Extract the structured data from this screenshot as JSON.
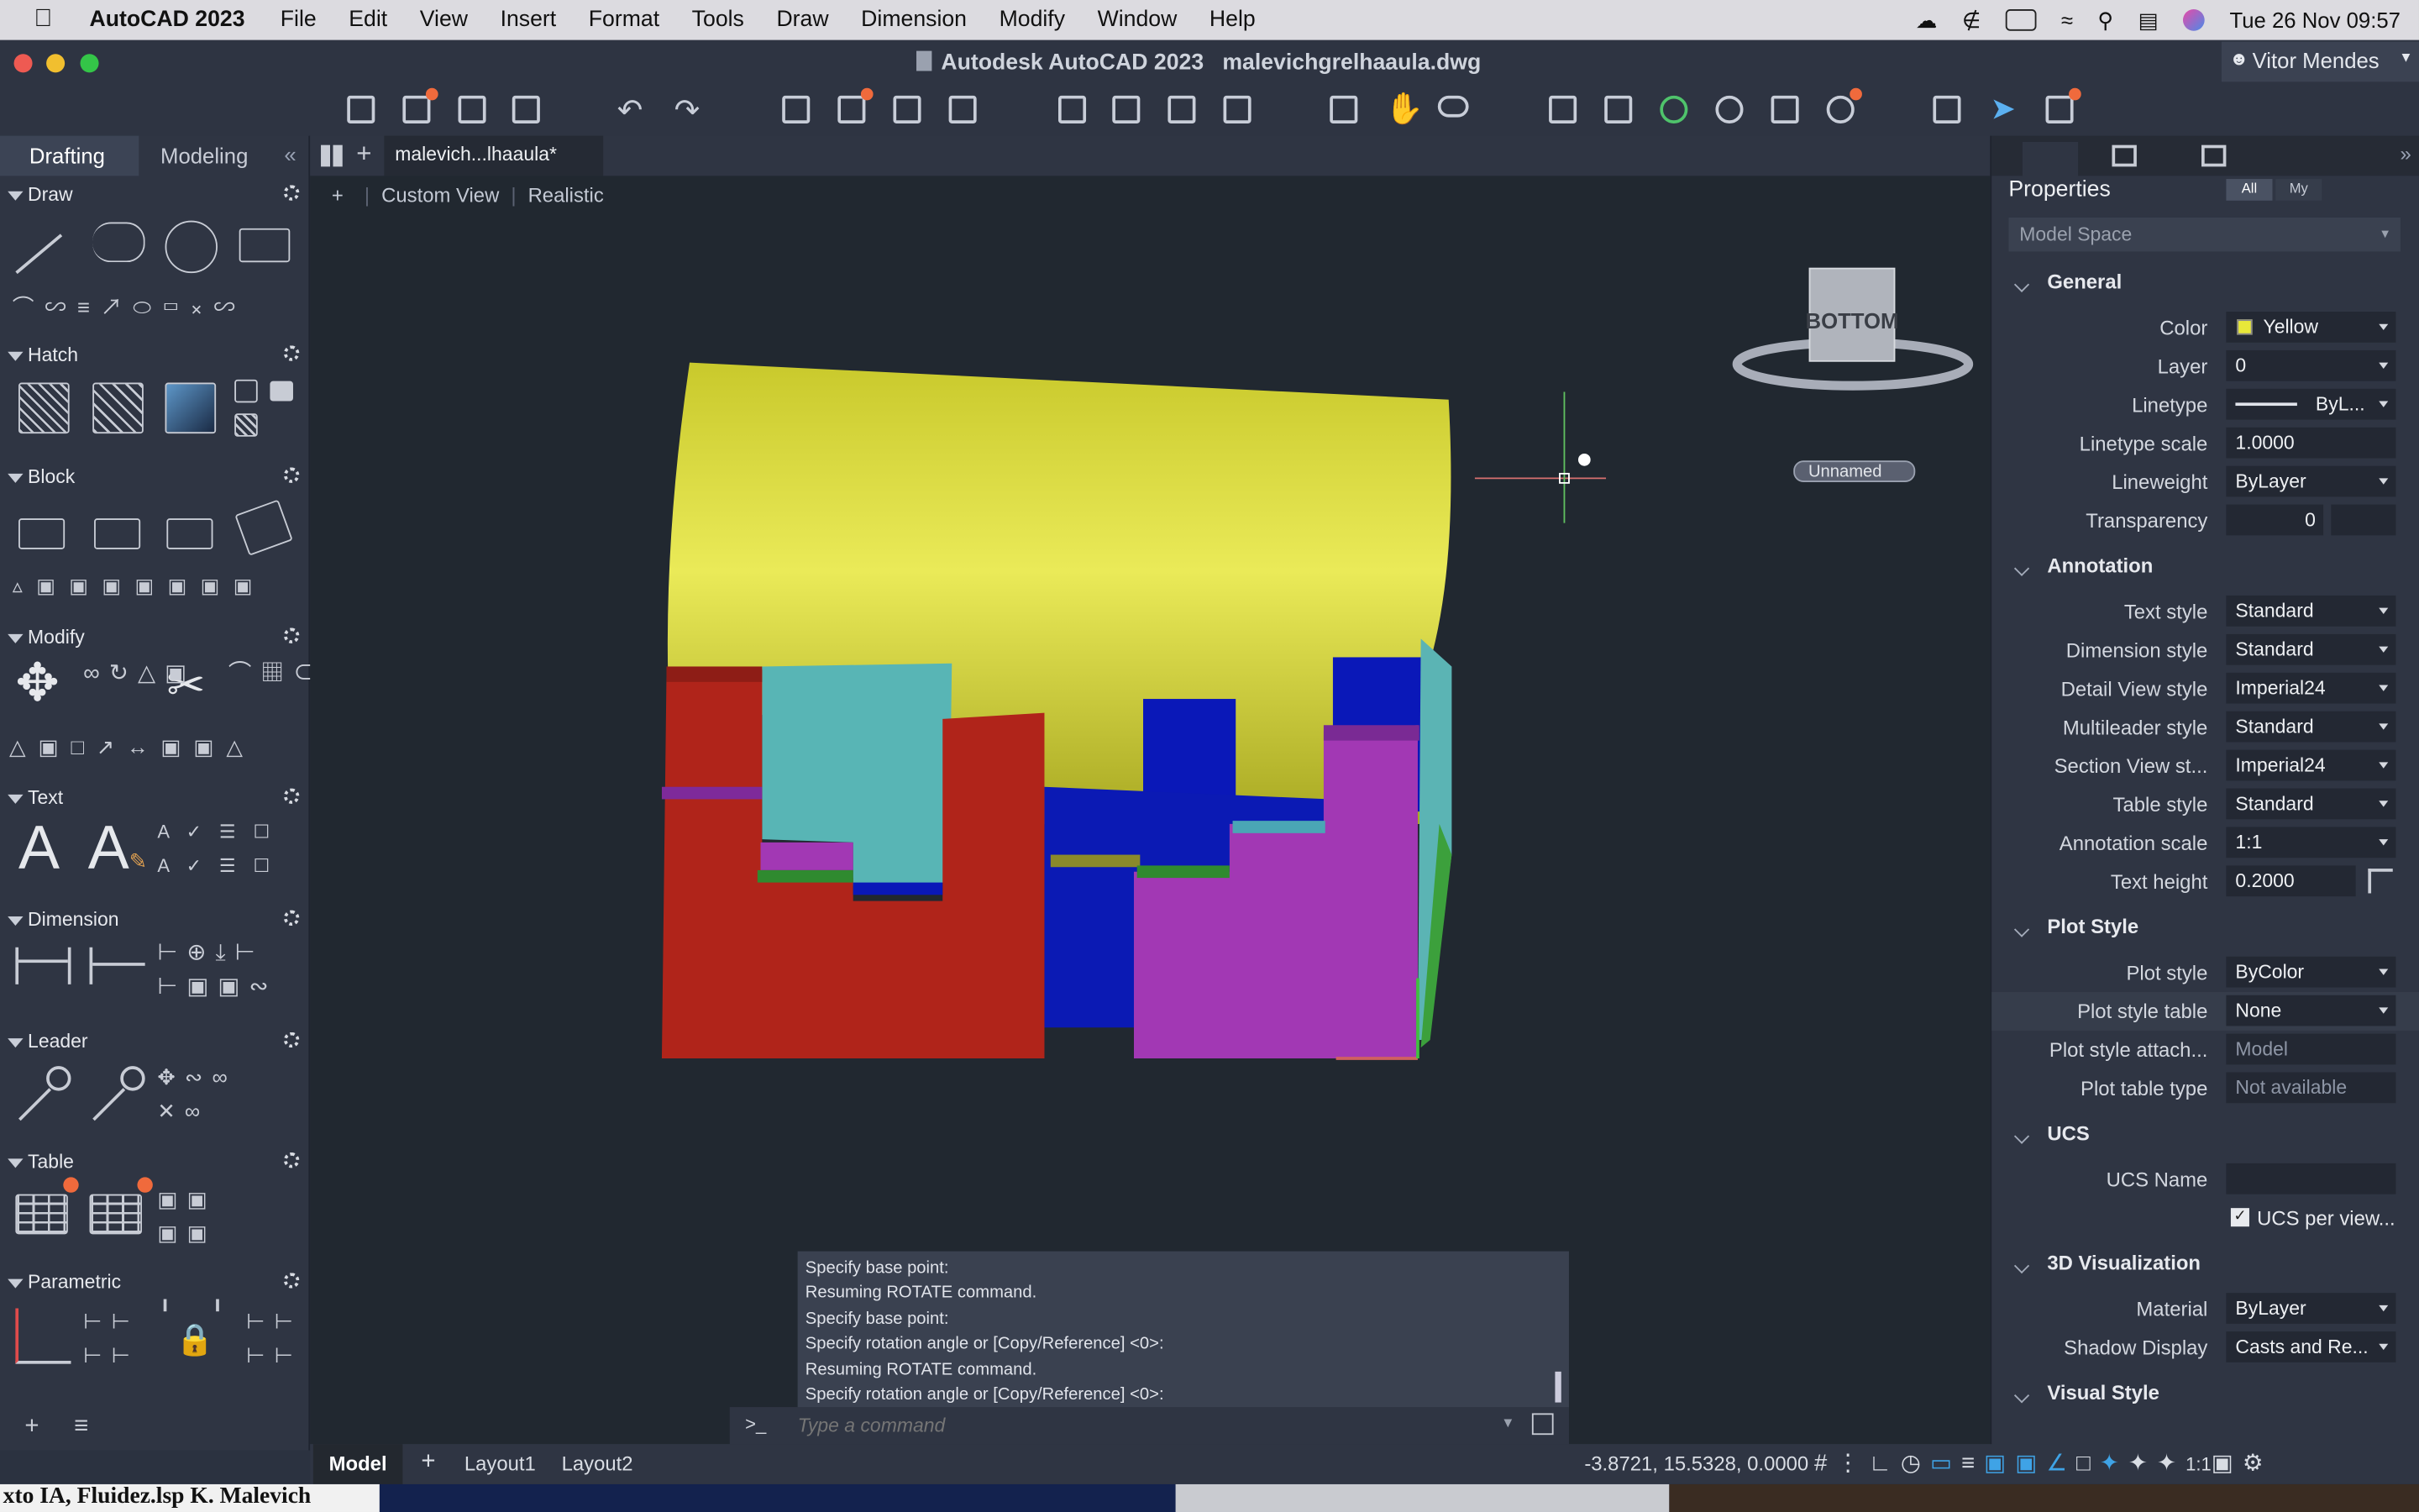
{
  "menubar": {
    "app_name": "AutoCAD 2023",
    "items": [
      "File",
      "Edit",
      "View",
      "Insert",
      "Format",
      "Tools",
      "Draw",
      "Dimension",
      "Modify",
      "Window",
      "Help"
    ],
    "clock": "Tue 26 Nov  09:57"
  },
  "window": {
    "title_app": "Autodesk AutoCAD 2023",
    "title_file": "malevichgrelhaaula.dwg",
    "user": "Vitor Mendes"
  },
  "palette": {
    "tabs": [
      "Drafting",
      "Modeling"
    ],
    "sections": [
      "Draw",
      "Hatch",
      "Block",
      "Modify",
      "Text",
      "Dimension",
      "Leader",
      "Table",
      "Parametric"
    ]
  },
  "doc": {
    "tab": "malevich...lhaaula*",
    "vp_plus": "+",
    "vp_view": "Custom View",
    "vp_style": "Realistic",
    "viewcube_face": "BOTTOM",
    "ucs_label": "Unnamed"
  },
  "command": {
    "history": [
      "Specify base point:",
      "Resuming ROTATE command.",
      "Specify base point:",
      "Specify rotation angle or [Copy/Reference] <0>:",
      "Resuming ROTATE command.",
      "Specify rotation angle or [Copy/Reference] <0>:"
    ],
    "prompt_icon": ">_",
    "placeholder": "Type a command"
  },
  "properties": {
    "title": "Properties",
    "filter_all": "All",
    "filter_my": "My",
    "selection": "Model Space",
    "groups": {
      "general": "General",
      "annotation": "Annotation",
      "plot_style": "Plot Style",
      "ucs": "UCS",
      "viz3d": "3D Visualization",
      "visual_style": "Visual Style"
    },
    "general": [
      {
        "label": "Color",
        "value": "Yellow"
      },
      {
        "label": "Layer",
        "value": "0"
      },
      {
        "label": "Linetype",
        "value": "ByL..."
      },
      {
        "label": "Linetype scale",
        "value": "1.0000"
      },
      {
        "label": "Lineweight",
        "value": "ByLayer"
      },
      {
        "label": "Transparency",
        "value": "0"
      }
    ],
    "annotation": [
      {
        "label": "Text style",
        "value": "Standard"
      },
      {
        "label": "Dimension style",
        "value": "Standard"
      },
      {
        "label": "Detail View style",
        "value": "Imperial24"
      },
      {
        "label": "Multileader style",
        "value": "Standard"
      },
      {
        "label": "Section View st...",
        "value": "Imperial24"
      },
      {
        "label": "Table style",
        "value": "Standard"
      },
      {
        "label": "Annotation scale",
        "value": "1:1"
      },
      {
        "label": "Text height",
        "value": "0.2000"
      }
    ],
    "plot": [
      {
        "label": "Plot style",
        "value": "ByColor"
      },
      {
        "label": "Plot style table",
        "value": "None"
      },
      {
        "label": "Plot style attach...",
        "value": "Model"
      },
      {
        "label": "Plot table type",
        "value": "Not available"
      }
    ],
    "ucs": [
      {
        "label": "UCS Name",
        "value": ""
      },
      {
        "label": "",
        "value": "UCS per view..."
      }
    ],
    "viz3d": [
      {
        "label": "Material",
        "value": "ByLayer"
      },
      {
        "label": "Shadow Display",
        "value": "Casts and Re..."
      }
    ]
  },
  "statusbar": {
    "model": "Model",
    "layout1": "Layout1",
    "layout2": "Layout2",
    "coords": "-3.8721, 15.5328, 0.0000",
    "scale": "1:1"
  },
  "dock": {
    "text": "xto IA, Fluidez.lsp K. Malevich"
  },
  "colors": {
    "yellow": "#dada3c",
    "red": "#b0241a",
    "cyan": "#58b5b5",
    "blue": "#0a18b8",
    "magenta": "#a238b4",
    "accent": "#3fa3e6"
  }
}
